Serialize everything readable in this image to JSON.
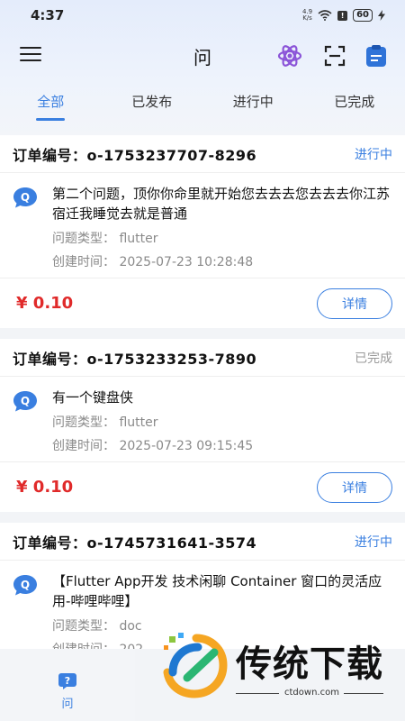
{
  "status_bar": {
    "time": "4:37",
    "speed_value": "4.9",
    "speed_unit": "K/s",
    "battery": "60",
    "sim_badge": "!"
  },
  "app_bar": {
    "title": "问",
    "icons": [
      "menu-icon",
      "atom-icon",
      "scan-icon",
      "clipboard-icon"
    ]
  },
  "tabs": [
    {
      "label": "全部",
      "active": true
    },
    {
      "label": "已发布",
      "active": false
    },
    {
      "label": "进行中",
      "active": false
    },
    {
      "label": "已完成",
      "active": false
    }
  ],
  "orders": [
    {
      "order_no": "订单编号：o-1753237707-8296",
      "status": "进行中",
      "status_color": "#3a7fe0",
      "title": "第二个问题，顶你你命里就开始您去去去您去去去你江苏宿迁我睡觉去就是普通",
      "type": "问题类型： flutter",
      "created": "创建时间： 2025-07-23 10:28:48",
      "price": "¥ 0.10",
      "detail": "详情"
    },
    {
      "order_no": "订单编号：o-1753233253-7890",
      "status": "已完成",
      "status_color": "#9a9a9a",
      "title": "有一个键盘侠",
      "type": "问题类型： flutter",
      "created": "创建时间： 2025-07-23 09:15:45",
      "price": "¥ 0.10",
      "detail": "详情"
    },
    {
      "order_no": "订单编号：o-1745731641-3574",
      "status": "进行中",
      "status_color": "#3a7fe0",
      "title": "【Flutter App开发 技术闲聊 Container 窗口的灵活应用-哔哩哔哩】",
      "type": "问题类型： doc",
      "created": "创建时间： 202",
      "price": "",
      "detail": ""
    }
  ],
  "bottom_nav": {
    "label": "问"
  },
  "watermark": {
    "text": "传统下载",
    "url": "ctdown.com"
  },
  "colors": {
    "accent": "#3a7fe0",
    "price": "#e02a2a"
  }
}
